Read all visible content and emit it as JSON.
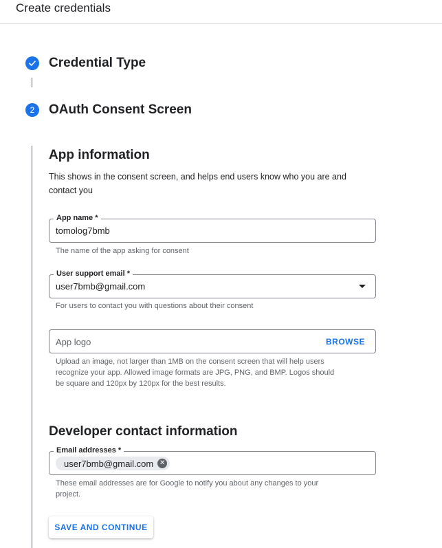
{
  "header": {
    "title": "Create credentials"
  },
  "steps": [
    {
      "icon": "check-icon",
      "label": "Credential Type"
    },
    {
      "number": "2",
      "label": "OAuth Consent Screen"
    }
  ],
  "app_info": {
    "title": "App information",
    "description_line1": "This shows in the consent screen, and helps end users know who you are and",
    "description_line2": "contact you",
    "app_name": {
      "label": "App name *",
      "value": "tomolog7bmb",
      "hint": "The name of the app asking for consent"
    },
    "support_email": {
      "label": "User support email *",
      "value": "user7bmb@gmail.com",
      "hint": "For users to contact you with questions about their consent"
    },
    "app_logo": {
      "placeholder": "App logo",
      "browse_label": "BROWSE",
      "hint_line1": "Upload an image, not larger than 1MB on the consent screen that will help users",
      "hint_line2": "recognize your app. Allowed image formats are JPG, PNG, and BMP. Logos should",
      "hint_line3": "be square and 120px by 120px for the best results."
    }
  },
  "developer_contact": {
    "title": "Developer contact information",
    "email_field": {
      "label": "Email addresses *",
      "chips": [
        "user7bmb@gmail.com"
      ],
      "hint_line1": "These email addresses are for Google to notify you about any changes to your",
      "hint_line2": "project."
    }
  },
  "actions": {
    "save_label": "SAVE AND CONTINUE"
  },
  "colors": {
    "accent": "#1a73e8",
    "border": "#80868b",
    "muted": "#5f6368"
  }
}
